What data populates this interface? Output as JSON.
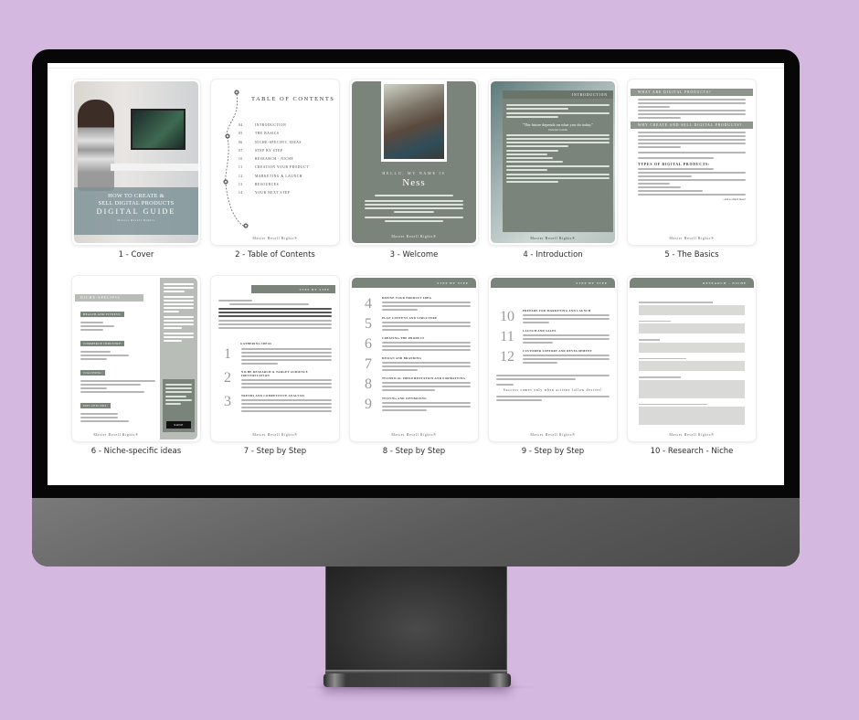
{
  "colors": {
    "background": "#d4b8df",
    "sage_accent": "#7b847a",
    "bezel": "#070707",
    "chin": "#5a5a5a"
  },
  "pages": [
    {
      "caption": "1 - Cover",
      "cover": {
        "title_line1": "HOW TO CREATE &",
        "title_line2": "SELL DIGITAL PRODUCTS",
        "title_line3": "DIGITAL GUIDE",
        "brand": "Master Resell Rights"
      }
    },
    {
      "caption": "2 - Table of Contents",
      "toc": {
        "title": "TABLE OF CONTENTS",
        "entries": [
          {
            "num": "04",
            "label": "INTRODUCTION"
          },
          {
            "num": "05",
            "label": "THE BASICS"
          },
          {
            "num": "06",
            "label": "NICHE-SPECIFIC IDEAS"
          },
          {
            "num": "07",
            "label": "STEP BY STEP"
          },
          {
            "num": "10",
            "label": "RESEARCH - NICHE"
          },
          {
            "num": "11",
            "label": "CREATION YOUR PRODUCT"
          },
          {
            "num": "12",
            "label": "MARKETING & LAUNCH"
          },
          {
            "num": "13",
            "label": "RESOURCES"
          },
          {
            "num": "14",
            "label": "YOUR NEXT STEP"
          }
        ],
        "footer": "Master Resell Rights®"
      }
    },
    {
      "caption": "3 - Welcome",
      "welcome": {
        "hello": "HELLO, MY NAME IS",
        "name": "Ness",
        "footer": "Master Resell Rights®"
      }
    },
    {
      "caption": "4 - Introduction",
      "intro": {
        "header": "INTRODUCTION",
        "quote": "\"The future depends on what you do today.\"",
        "quote_author": "Mahatma Gandhi",
        "footer": "Master Resell Rights®"
      }
    },
    {
      "caption": "5 - The Basics",
      "basics": {
        "heading1": "WHAT ARE DIGITAL PRODUCTS?",
        "heading2": "WHY CREATE AND SELL DIGITAL PRODUCTS?",
        "subheading": "TYPES OF DIGITAL PRODUCTS:",
        "closing": "...and so much more!",
        "footer": "Master Resell Rights®"
      }
    },
    {
      "caption": "6 - Niche-specific ideas",
      "niche": {
        "heading": "NICHE-SPECIFIC",
        "tags": [
          "HEALTH AND FITNESS:",
          "COMMERCE INDUSTRY:",
          "COACHING:",
          "INFLUENCERS:"
        ],
        "cta_button": "SHOP",
        "footer": "Master Resell Rights®"
      }
    },
    {
      "caption": "7 - Step by Step",
      "step7": {
        "header": "STEP BY STEP",
        "subheadings": [
          "GATHERING IDEAS",
          "NICHE RESEARCH & TARGET AUDIENCE IDENTIFICATION",
          "TRENDS AND COMPETITIVE ANALYSIS"
        ],
        "numbers": [
          "1",
          "2",
          "3"
        ],
        "footer": "Master Resell Rights®"
      }
    },
    {
      "caption": "8 - Step by Step",
      "step8": {
        "header": "STEP BY STEP",
        "steps": [
          {
            "num": "4",
            "title": "DEFINE YOUR PRODUCT IDEA"
          },
          {
            "num": "5",
            "title": "PLAN CONTENT AND STRUCTURE"
          },
          {
            "num": "6",
            "title": "CREATING THE PRODUCT"
          },
          {
            "num": "7",
            "title": "DESIGN AND BRANDING"
          },
          {
            "num": "8",
            "title": "TECHNICAL IMPLEMENTATION AND FORMATTING"
          },
          {
            "num": "9",
            "title": "TESTING AND OPTIMIZING"
          }
        ],
        "footer": "Master Resell Rights®"
      }
    },
    {
      "caption": "9 - Step by Step",
      "step9": {
        "header": "STEP BY STEP",
        "steps": [
          {
            "num": "10",
            "title": "PREPARE FOR MARKETING AND LAUNCH"
          },
          {
            "num": "11",
            "title": "LAUNCH AND SALES"
          },
          {
            "num": "12",
            "title": "CUSTOMER SUPPORT AND DEVELOPMENT"
          }
        ],
        "motto": "Success comes only when actions follow desires!",
        "footer": "Master Resell Rights®"
      }
    },
    {
      "caption": "10 - Research - Niche",
      "research": {
        "header": "RESEARCH - NICHE",
        "footer": "Master Resell Rights®"
      }
    }
  ]
}
